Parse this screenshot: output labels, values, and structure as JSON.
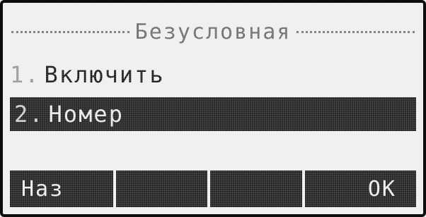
{
  "screen": {
    "title": "Безусловная"
  },
  "menu": {
    "items": [
      {
        "number": "1.",
        "label": "Включить",
        "selected": false
      },
      {
        "number": "2.",
        "label": "Номер",
        "selected": true
      }
    ]
  },
  "softkeys": {
    "left": "Наз",
    "middle_1": "",
    "middle_2": "",
    "right": "ОК"
  },
  "colors": {
    "screen_background": "#efefef",
    "highlight": "#262626",
    "text_dark": "#1d1d1d",
    "text_light": "#e9e9e9"
  }
}
